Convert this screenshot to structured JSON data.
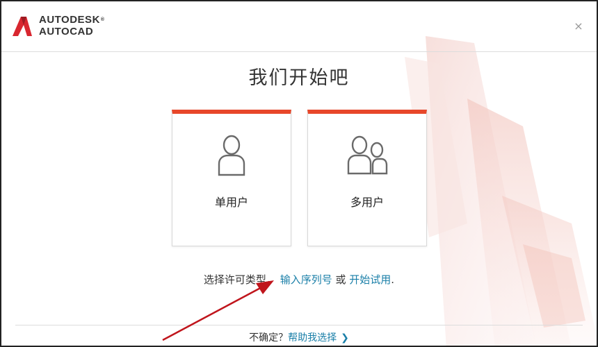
{
  "brand": {
    "line1": "AUTODESK",
    "line2": "AUTOCAD",
    "accent": "#e8472a"
  },
  "window": {
    "close_glyph": "×"
  },
  "main": {
    "title": "我们开始吧",
    "cards": [
      {
        "label": "单用户",
        "icon": "single-user-icon"
      },
      {
        "label": "多用户",
        "icon": "multi-user-icon"
      }
    ],
    "license": {
      "prefix": "选择许可类型，",
      "serial_link": "输入序列号",
      "or_text": " 或 ",
      "trial_link": "开始试用",
      "suffix": "."
    }
  },
  "footer": {
    "unsure_text": "不确定？",
    "help_link": "帮助我选择",
    "chevron": "❯"
  },
  "colors": {
    "link": "#1a7fa8",
    "card_top": "#e8472a",
    "annotation_arrow": "#c0151c"
  }
}
